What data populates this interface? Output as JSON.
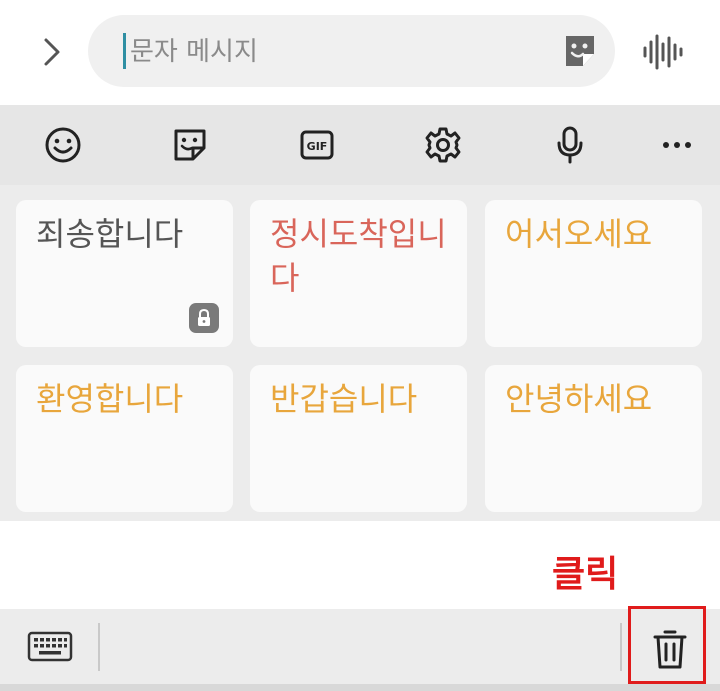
{
  "compose": {
    "placeholder": "문자 메시지",
    "expand_icon": "chevron-right-icon",
    "sticker_icon": "sticker-icon",
    "voice_icon": "voice-waveform-icon"
  },
  "toolbar": {
    "items": [
      {
        "name": "emoji-icon"
      },
      {
        "name": "sticker-icon"
      },
      {
        "name": "gif-icon",
        "label": "GIF"
      },
      {
        "name": "settings-gear-icon"
      },
      {
        "name": "microphone-icon"
      },
      {
        "name": "more-dots-icon"
      }
    ]
  },
  "phrases": [
    {
      "text": "죄송합니다",
      "color": "#555555",
      "locked": true
    },
    {
      "text": "정시도착입니다",
      "color": "#d9655a",
      "locked": false
    },
    {
      "text": "어서오세요",
      "color": "#e8a63c",
      "locked": false
    },
    {
      "text": "환영합니다",
      "color": "#e8a63c",
      "locked": false
    },
    {
      "text": "반갑습니다",
      "color": "#e8a63c",
      "locked": false
    },
    {
      "text": "안녕하세요",
      "color": "#e8a63c",
      "locked": false
    }
  ],
  "annotation": {
    "text": "클릭",
    "color": "#e01b1b"
  },
  "bottom_bar": {
    "keyboard_icon": "keyboard-icon",
    "delete_icon": "trash-icon"
  }
}
